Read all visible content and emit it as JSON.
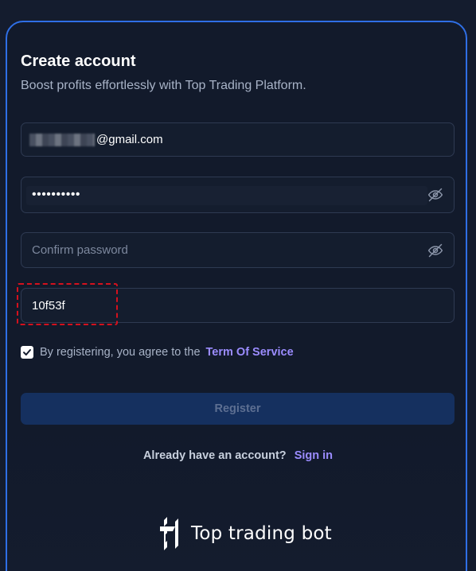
{
  "header": {
    "title": "Create account",
    "subtitle": "Boost profits effortlessly with Top Trading Platform."
  },
  "form": {
    "email": {
      "value_visible": "@gmail.com",
      "icon": "redacted-blur"
    },
    "password": {
      "value_masked": "••••••••••",
      "toggle_icon": "eye-off-icon"
    },
    "confirm_password": {
      "value": "",
      "placeholder": "Confirm password",
      "toggle_icon": "eye-off-icon"
    },
    "code": {
      "value": "10f53f",
      "highlight_color": "#d4111d"
    },
    "agree": {
      "checked": true,
      "text": "By registering, you agree to the",
      "link": "Term Of Service"
    },
    "register_label": "Register"
  },
  "footer": {
    "question": "Already have an account?",
    "signin_label": "Sign in",
    "brand": "Top trading bot"
  },
  "colors": {
    "accent": "#9b8cff",
    "border": "#2f6fe6",
    "button_bg": "#15305f"
  }
}
